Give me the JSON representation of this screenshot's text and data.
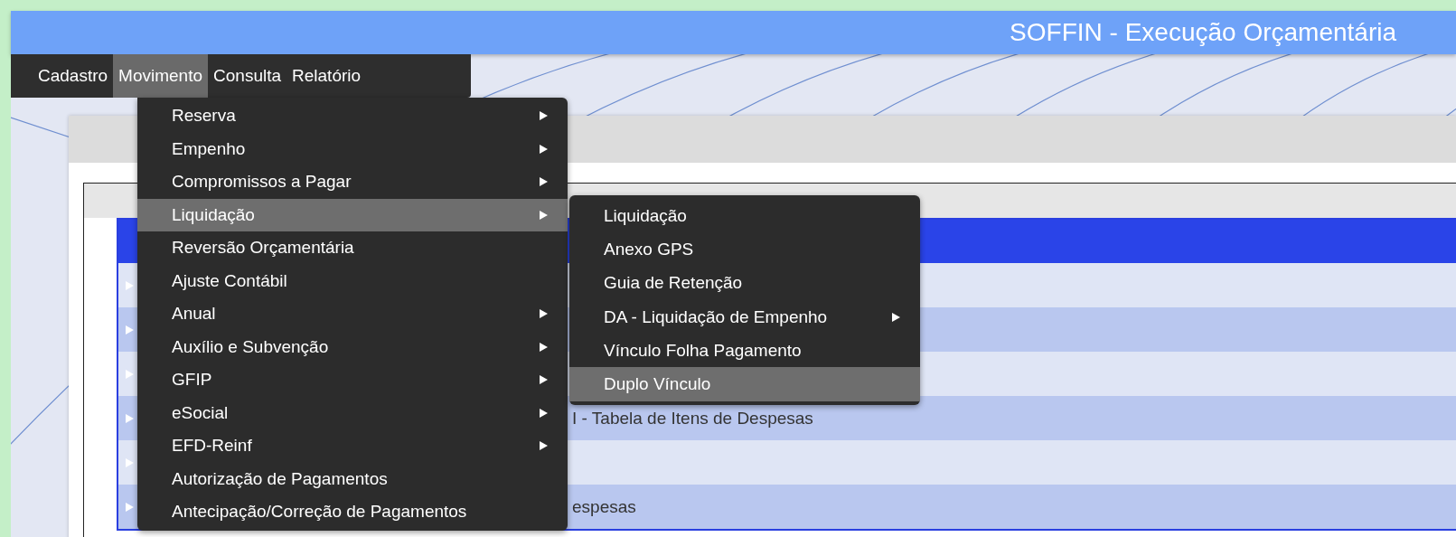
{
  "window": {
    "title": "SOFFIN - Execução Orçamentária"
  },
  "menubar": [
    {
      "label": "Cadastro",
      "selected": false
    },
    {
      "label": "Movimento",
      "selected": true
    },
    {
      "label": "Consulta",
      "selected": false
    },
    {
      "label": "Relatório",
      "selected": false
    }
  ],
  "dropdown": [
    {
      "label": "Reserva",
      "submenu": true,
      "selected": false
    },
    {
      "label": "Empenho",
      "submenu": true,
      "selected": false
    },
    {
      "label": "Compromissos a Pagar",
      "submenu": true,
      "selected": false
    },
    {
      "label": "Liquidação",
      "submenu": true,
      "selected": true
    },
    {
      "label": "Reversão Orçamentária",
      "submenu": false,
      "selected": false
    },
    {
      "label": "Ajuste Contábil",
      "submenu": false,
      "selected": false
    },
    {
      "label": "Anual",
      "submenu": true,
      "selected": false
    },
    {
      "label": "Auxílio e Subvenção",
      "submenu": true,
      "selected": false
    },
    {
      "label": "GFIP",
      "submenu": true,
      "selected": false
    },
    {
      "label": "eSocial",
      "submenu": true,
      "selected": false
    },
    {
      "label": "EFD-Reinf",
      "submenu": true,
      "selected": false
    },
    {
      "label": "Autorização de Pagamentos",
      "submenu": false,
      "selected": false
    },
    {
      "label": "Antecipação/Correção de Pagamentos",
      "submenu": false,
      "selected": false
    }
  ],
  "submenu": [
    {
      "label": "Liquidação",
      "submenu": false,
      "selected": false
    },
    {
      "label": "Anexo GPS",
      "submenu": false,
      "selected": false
    },
    {
      "label": "Guia de Retenção",
      "submenu": false,
      "selected": false
    },
    {
      "label": "DA - Liquidação de Empenho",
      "submenu": true,
      "selected": false
    },
    {
      "label": "Vínculo Folha Pagamento",
      "submenu": false,
      "selected": false
    },
    {
      "label": "Duplo Vínculo",
      "submenu": false,
      "selected": true
    }
  ],
  "table": {
    "rows": [
      {},
      {},
      {},
      {
        "title": "I - Tabela de Itens de Despesas"
      },
      {},
      {
        "title": "espesas"
      }
    ]
  }
}
